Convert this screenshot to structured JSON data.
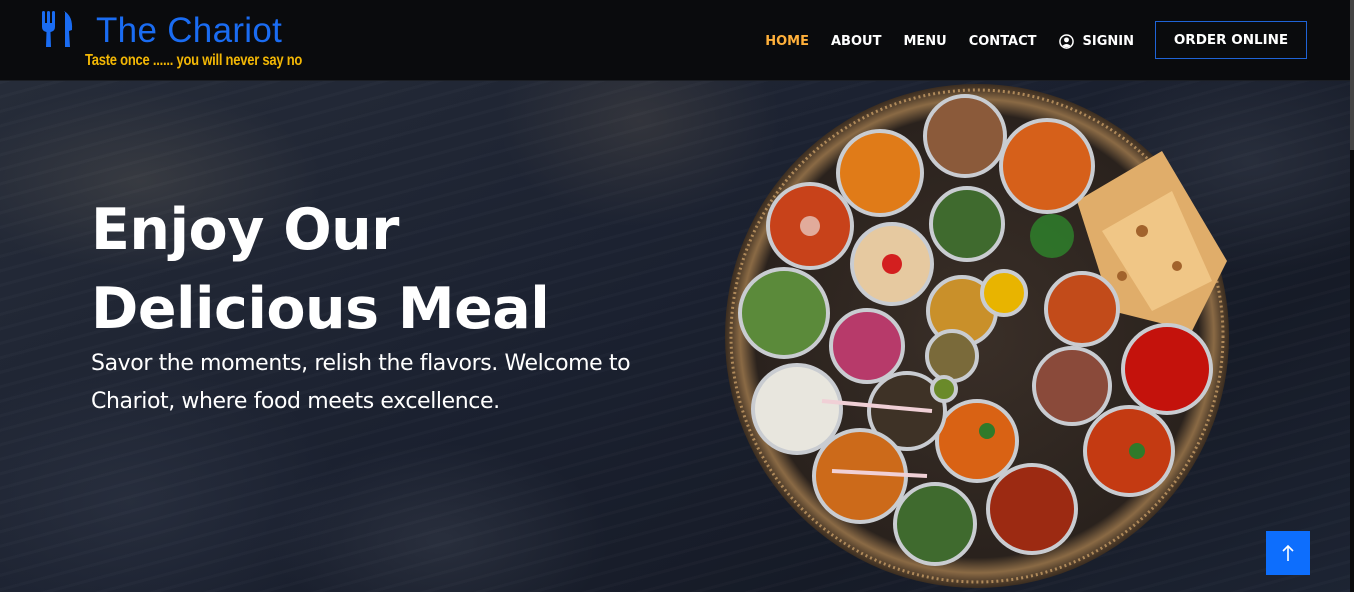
{
  "header": {
    "logo": {
      "title": "The Chariot",
      "tagline": "Taste once ...... you will never say no",
      "icon": "utensils-icon"
    },
    "nav": [
      {
        "label": "HOME",
        "active": true
      },
      {
        "label": "ABOUT",
        "active": false
      },
      {
        "label": "MENU",
        "active": false
      },
      {
        "label": "CONTACT",
        "active": false
      },
      {
        "label": "SIGNIN",
        "active": false,
        "icon": "user-circle-icon"
      }
    ],
    "order_button": "ORDER ONLINE"
  },
  "hero": {
    "title_line1": "Enjoy Our",
    "title_line2": "Delicious Meal",
    "subtitle": "Savor the moments, relish the flavors. Welcome to Chariot, where food meets excellence.",
    "image": "indian-thali-platter"
  },
  "scroll_top_icon": "arrow-up-icon",
  "colors": {
    "brand_blue": "#1a6cf2",
    "tagline_yellow": "#f2b705",
    "nav_active": "#ffb03b",
    "button_blue": "#0d6efd",
    "header_bg": "#0a0b0d"
  }
}
